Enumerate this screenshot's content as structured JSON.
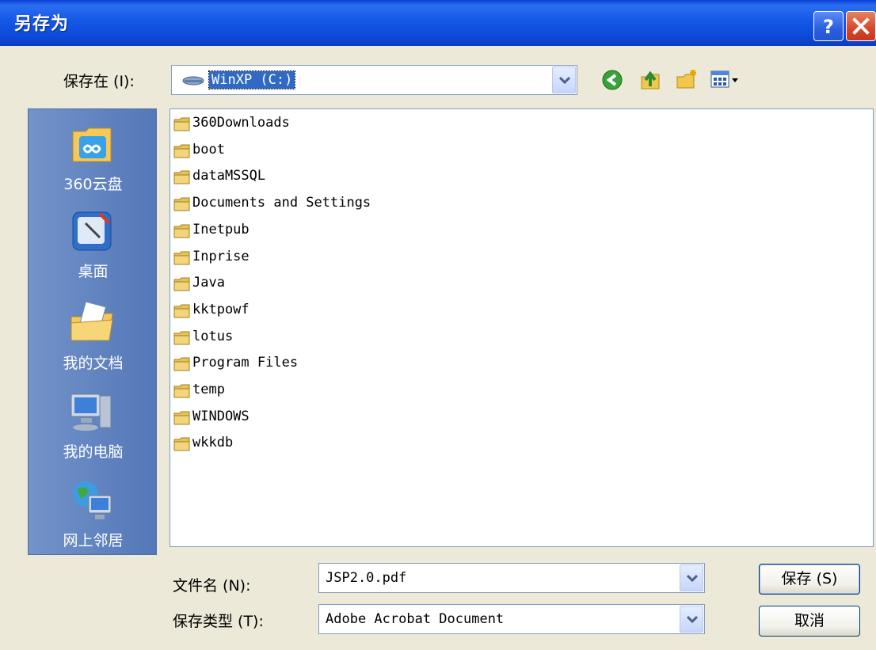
{
  "window": {
    "title": "另存为",
    "help_label": "?"
  },
  "location": {
    "label": "保存在 (I):",
    "value": "WinXP (C:)",
    "toolbar_icons": [
      "back-icon",
      "up-folder-icon",
      "new-folder-icon",
      "views-menu-icon"
    ]
  },
  "places": [
    {
      "label": "360云盘",
      "icon": "cloud-drive-icon"
    },
    {
      "label": "桌面",
      "icon": "desktop-icon"
    },
    {
      "label": "我的文档",
      "icon": "my-documents-icon"
    },
    {
      "label": "我的电脑",
      "icon": "my-computer-icon"
    },
    {
      "label": "网上邻居",
      "icon": "network-places-icon"
    }
  ],
  "files": [
    "360Downloads",
    "boot",
    "dataMSSQL",
    "Documents and Settings",
    "Inetpub",
    "Inprise",
    "Java",
    "kktpowf",
    "lotus",
    "Program Files",
    "temp",
    "WINDOWS",
    "wkkdb"
  ],
  "filename": {
    "label": "文件名 (N):",
    "value": "JSP2.0.pdf"
  },
  "filetype": {
    "label": "保存类型 (T):",
    "value": "Adobe Acrobat Document"
  },
  "buttons": {
    "save": "保存 (S)",
    "cancel": "取消"
  },
  "colors": {
    "titlebar": "#0d4ad8",
    "dialog_bg": "#ece9d8",
    "places_bar": "#5f82c1",
    "selection": "#316ac5"
  }
}
